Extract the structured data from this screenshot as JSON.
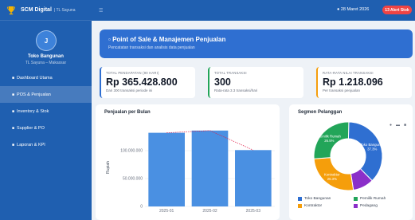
{
  "app": {
    "name": "SCM Digital",
    "subtitle": "| TL Sayuna",
    "accent": "#1f5fb0"
  },
  "user": {
    "initial": "J",
    "store": "Toko Bangunan",
    "location": "TL Sayuna – Makassar"
  },
  "sidebar": {
    "items": [
      {
        "icon": "dashboard-icon",
        "label": "Dashboard Utama",
        "active": false
      },
      {
        "icon": "cart-icon",
        "label": "POS & Penjualan",
        "active": true
      },
      {
        "icon": "box-icon",
        "label": "Inventory & Stok",
        "active": false
      },
      {
        "icon": "truck-icon",
        "label": "Supplier & PO",
        "active": false
      },
      {
        "icon": "report-icon",
        "label": "Laporan & KPI",
        "active": false
      }
    ]
  },
  "topbar": {
    "date": "28 Maret 2026",
    "alert": "13 Alert Stok"
  },
  "hero": {
    "title": "Point of Sale & Manajemen Penjualan",
    "subtitle": "Pencatatan transaksi dan analisis data penjualan"
  },
  "kpis": [
    {
      "label": "TOTAL PENDAPATAN (90 HARI)",
      "value": "Rp 365.428.800",
      "sub": "Dari 300 transaksi periode ini",
      "color": "#2f6fd1"
    },
    {
      "label": "TOTAL TRANSAKSI",
      "value": "300",
      "sub": "Rata-rata 3.3 transaksi/hari",
      "color": "#22a559"
    },
    {
      "label": "RATA-RATA NILAI TRANSAKSI",
      "value": "Rp 1.218.096",
      "sub": "Per transaksi penjualan",
      "color": "#f59e0b"
    }
  ],
  "sales_card": {
    "title": "Penjualan per Bulan"
  },
  "segment_card": {
    "title": "Segmen Pelanggan"
  },
  "chart_data": [
    {
      "type": "bar",
      "title": "Penjualan per Bulan",
      "xlabel": "",
      "ylabel": "Rupiah",
      "categories": [
        "2025-01",
        "2025-02",
        "2025-03"
      ],
      "values": [
        132000000,
        136000000,
        101000000
      ],
      "yticks": [
        "0",
        "50.000.000",
        "100.000.000"
      ],
      "ylim": [
        0,
        140000000
      ],
      "bar_color": "#4a90e2",
      "trend_line": {
        "values": [
          132000000,
          136000000,
          101000000
        ],
        "color": "#e11d48",
        "style": "dotted"
      },
      "grid": true
    },
    {
      "type": "pie",
      "title": "Segmen Pelanggan",
      "donut": true,
      "slices": [
        {
          "label": "Toko Bangunan",
          "pct": "37.3%",
          "value": 37.3,
          "color": "#2f6fd1"
        },
        {
          "label": "Pedagang",
          "pct": "9.9%",
          "value": 9.9,
          "color": "#8b2fc9"
        },
        {
          "label": "Kontraktor",
          "pct": "26.3%",
          "value": 26.3,
          "color": "#f59e0b"
        },
        {
          "label": "Pemilik Rumah",
          "pct": "26.5%",
          "value": 26.5,
          "color": "#22a559"
        }
      ],
      "legend_order": [
        "Toko Bangunan",
        "Pemilik Rumah",
        "Kontraktor",
        "Pedagang"
      ],
      "legend_position": "bottom"
    }
  ]
}
